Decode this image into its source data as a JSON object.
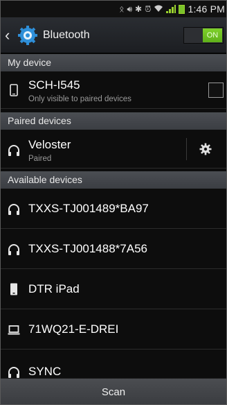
{
  "status_bar": {
    "time": "1:46 PM",
    "icons": [
      "nfc-icon",
      "sound-icon",
      "bluetooth-icon",
      "alarm-icon",
      "wifi-icon",
      "signal-icon",
      "battery-icon"
    ]
  },
  "action_bar": {
    "title": "Bluetooth",
    "toggle_label": "ON",
    "accent": "#7fd12a"
  },
  "sections": {
    "my_device": "My device",
    "paired": "Paired devices",
    "available": "Available devices"
  },
  "my_device": {
    "name": "SCH-I545",
    "subtitle": "Only visible to paired devices"
  },
  "paired_devices": [
    {
      "name": "Veloster",
      "status": "Paired",
      "icon": "headphones-icon"
    }
  ],
  "available_devices": [
    {
      "name": "TXXS-TJ001489*BA97",
      "icon": "headphones-icon"
    },
    {
      "name": "TXXS-TJ001488*7A56",
      "icon": "headphones-icon"
    },
    {
      "name": "DTR iPad",
      "icon": "tablet-icon"
    },
    {
      "name": "71WQ21-E-DREI",
      "icon": "laptop-icon"
    },
    {
      "name": "SYNC",
      "icon": "headphones-icon"
    }
  ],
  "scan_label": "Scan"
}
